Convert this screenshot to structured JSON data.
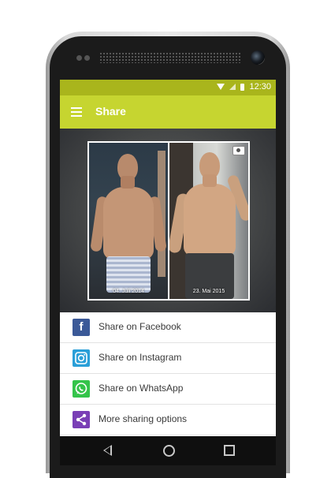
{
  "statusbar": {
    "time": "12:30"
  },
  "appbar": {
    "title": "Share",
    "menu_icon": "hamburger-menu-icon"
  },
  "photos": [
    {
      "date": "04. Juli 2014"
    },
    {
      "date": "23. Mai 2015"
    }
  ],
  "share_options": [
    {
      "label": "Share on Facebook",
      "icon": "facebook-icon",
      "color": "#3b5998"
    },
    {
      "label": "Share on Instagram",
      "icon": "instagram-icon",
      "color": "#2a9fd8"
    },
    {
      "label": "Share on WhatsApp",
      "icon": "whatsapp-icon",
      "color": "#34c44a"
    },
    {
      "label": "More sharing options",
      "icon": "share-icon",
      "color": "#7a3fb6"
    }
  ],
  "colors": {
    "statusbar": "#a9b51c",
    "appbar": "#c6d530",
    "navbar": "#0f0f0f"
  }
}
